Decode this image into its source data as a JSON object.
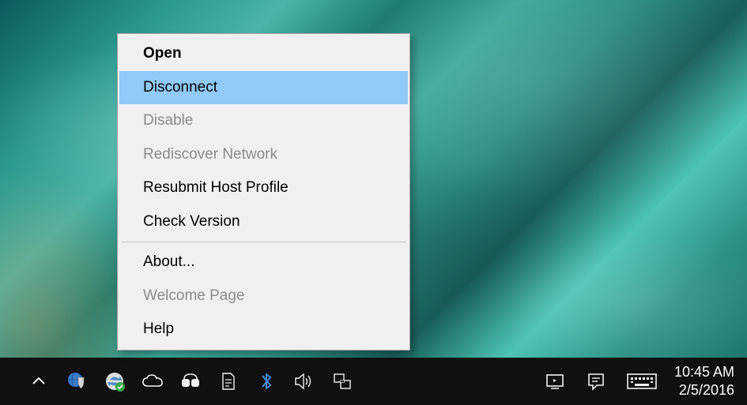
{
  "context_menu": {
    "items": [
      {
        "label": "Open",
        "bold": true,
        "disabled": false,
        "highlighted": false
      },
      {
        "label": "Disconnect",
        "bold": false,
        "disabled": false,
        "highlighted": true
      },
      {
        "label": "Disable",
        "bold": false,
        "disabled": true,
        "highlighted": false
      },
      {
        "label": "Rediscover Network",
        "bold": false,
        "disabled": true,
        "highlighted": false
      },
      {
        "label": "Resubmit Host Profile",
        "bold": false,
        "disabled": false,
        "highlighted": false
      },
      {
        "label": "Check Version",
        "bold": false,
        "disabled": false,
        "highlighted": false
      },
      {
        "separator": true
      },
      {
        "label": "About...",
        "bold": false,
        "disabled": false,
        "highlighted": false
      },
      {
        "label": "Welcome Page",
        "bold": false,
        "disabled": true,
        "highlighted": false
      },
      {
        "label": "Help",
        "bold": false,
        "disabled": false,
        "highlighted": false
      }
    ]
  },
  "taskbar": {
    "tray_icons": [
      "chevron-up-icon",
      "shield-globe-icon",
      "sync-green-icon",
      "cloud-icon",
      "audio-device-icon",
      "document-icon",
      "bluetooth-icon",
      "speaker-icon",
      "network-icon"
    ],
    "system_icons": [
      "screen-icon",
      "action-center-icon",
      "keyboard-icon"
    ],
    "clock": {
      "time": "10:45 AM",
      "date": "2/5/2016"
    }
  }
}
